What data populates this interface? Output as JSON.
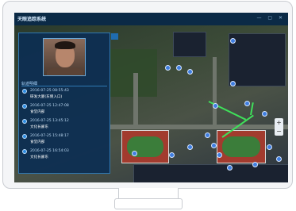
{
  "app": {
    "title": "天眼追踪系统",
    "window_controls": "— ▢ ✕"
  },
  "panel": {
    "section_title": "轨迹明细",
    "records": [
      {
        "time": "2016-07-25 08:55:43",
        "location": "研发大厦(东侧入口)"
      },
      {
        "time": "2016-07-25 12:47:08",
        "location": "食堂内部"
      },
      {
        "time": "2016-07-25 13:45:12",
        "location": "文化长廊东"
      },
      {
        "time": "2016-07-25 15:48:17",
        "location": "食堂内部"
      },
      {
        "time": "2016-07-25 16:54:03",
        "location": "文化长廊东"
      }
    ]
  },
  "map": {
    "zoom_in": "+",
    "zoom_out": "−"
  },
  "icons": {
    "person": "person-photo",
    "marker": "camera-marker-icon"
  },
  "colors": {
    "accent": "#2c8be0",
    "track_line": "#3fe05a",
    "panel_bg": "#0c2e52"
  }
}
